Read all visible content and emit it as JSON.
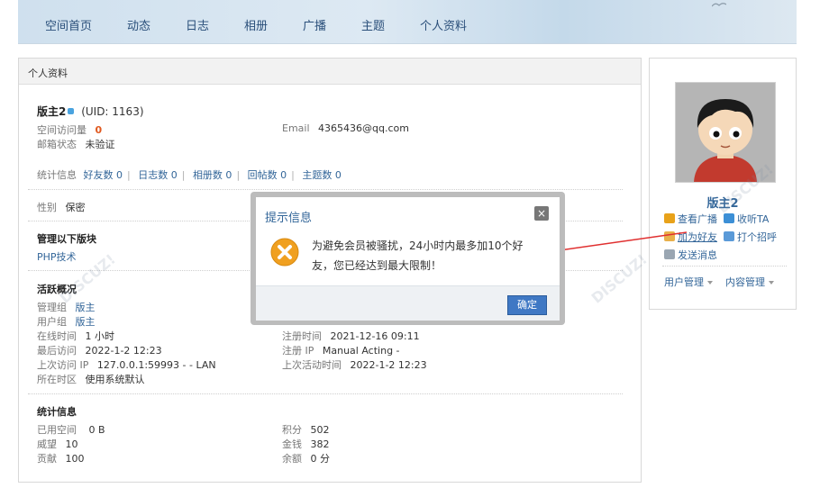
{
  "nav": {
    "items": [
      "空间首页",
      "动态",
      "日志",
      "相册",
      "广播",
      "主题",
      "个人资料"
    ]
  },
  "panel": {
    "title": "个人资料"
  },
  "profile": {
    "username": "版主2",
    "uid": "(UID: 1163)",
    "visits_label": "空间访问量",
    "visits_value": "0",
    "email_label": "Email",
    "email_value": "4365436@qq.com",
    "email_status_label": "邮箱状态",
    "email_status_value": "未验证"
  },
  "stats_line": {
    "label": "统计信息",
    "friends": "好友数 0",
    "blogs": "日志数 0",
    "albums": "相册数 0",
    "replies": "回帖数 0",
    "threads": "主题数 0"
  },
  "gender": {
    "label": "性别",
    "value": "保密"
  },
  "moderation": {
    "title": "管理以下版块",
    "forum": "PHP技术"
  },
  "activity": {
    "title": "活跃概况",
    "admin_group_label": "管理组",
    "admin_group_value": "版主",
    "user_group_label": "用户组",
    "user_group_value": "版主",
    "online_time_label": "在线时间",
    "online_time_value": "1 小时",
    "reg_time_label": "注册时间",
    "reg_time_value": "2021-12-16 09:11",
    "last_visit_label": "最后访问",
    "last_visit_value": "2022-1-2 12:23",
    "reg_ip_label": "注册 IP",
    "reg_ip_value": "Manual Acting -",
    "last_ip_label": "上次访问 IP",
    "last_ip_value": "127.0.0.1:59993 - - LAN",
    "last_active_label": "上次活动时间",
    "last_active_value": "2022-1-2 12:23",
    "timezone_label": "所在时区",
    "timezone_value": "使用系统默认"
  },
  "stats": {
    "title": "统计信息",
    "space_label": "已用空间",
    "space_value": "0 B",
    "points_label": "积分",
    "points_value": "502",
    "prestige_label": "威望",
    "prestige_value": "10",
    "money_label": "金钱",
    "money_value": "382",
    "contrib_label": "贡献",
    "contrib_value": "100",
    "balance_label": "余额",
    "balance_value": "0 分"
  },
  "card": {
    "username": "版主2",
    "actions": {
      "view_broadcast": "查看广播",
      "listen": "收听TA",
      "add_friend": "加为好友",
      "greet": "打个招呼",
      "send_message": "发送消息"
    },
    "menu": {
      "user_manage": "用户管理",
      "content_manage": "内容管理"
    },
    "icon_color_view": "#e8a21a",
    "icon_color_listen": "#3c8fd6"
  },
  "dialog": {
    "title": "提示信息",
    "message": "为避免会员被骚扰，24小时内最多加10个好友，您已经达到最大限制！",
    "confirm_label": "确定",
    "icon": "warning-x-icon",
    "icon_color": "#f0a020"
  },
  "annotation": {
    "arrow_color": "#e03030"
  }
}
